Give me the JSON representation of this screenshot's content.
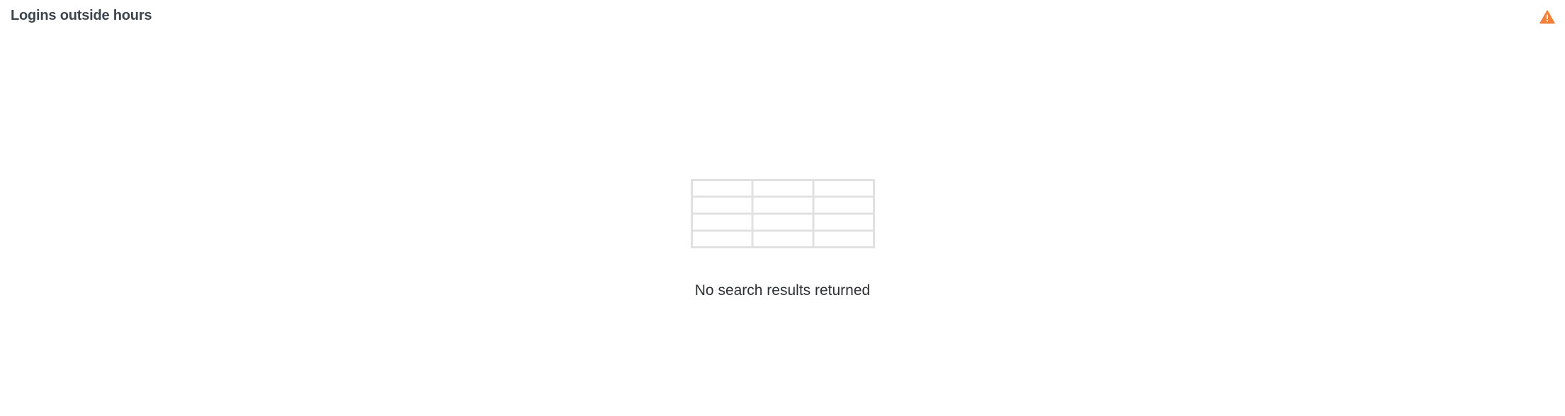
{
  "panel": {
    "title": "Logins outside hours",
    "status_icon": "warning-icon",
    "status_color": "#f1813f"
  },
  "empty_state": {
    "icon": "empty-table-icon",
    "message": "No search results returned",
    "icon_color": "#e1e1e1"
  }
}
